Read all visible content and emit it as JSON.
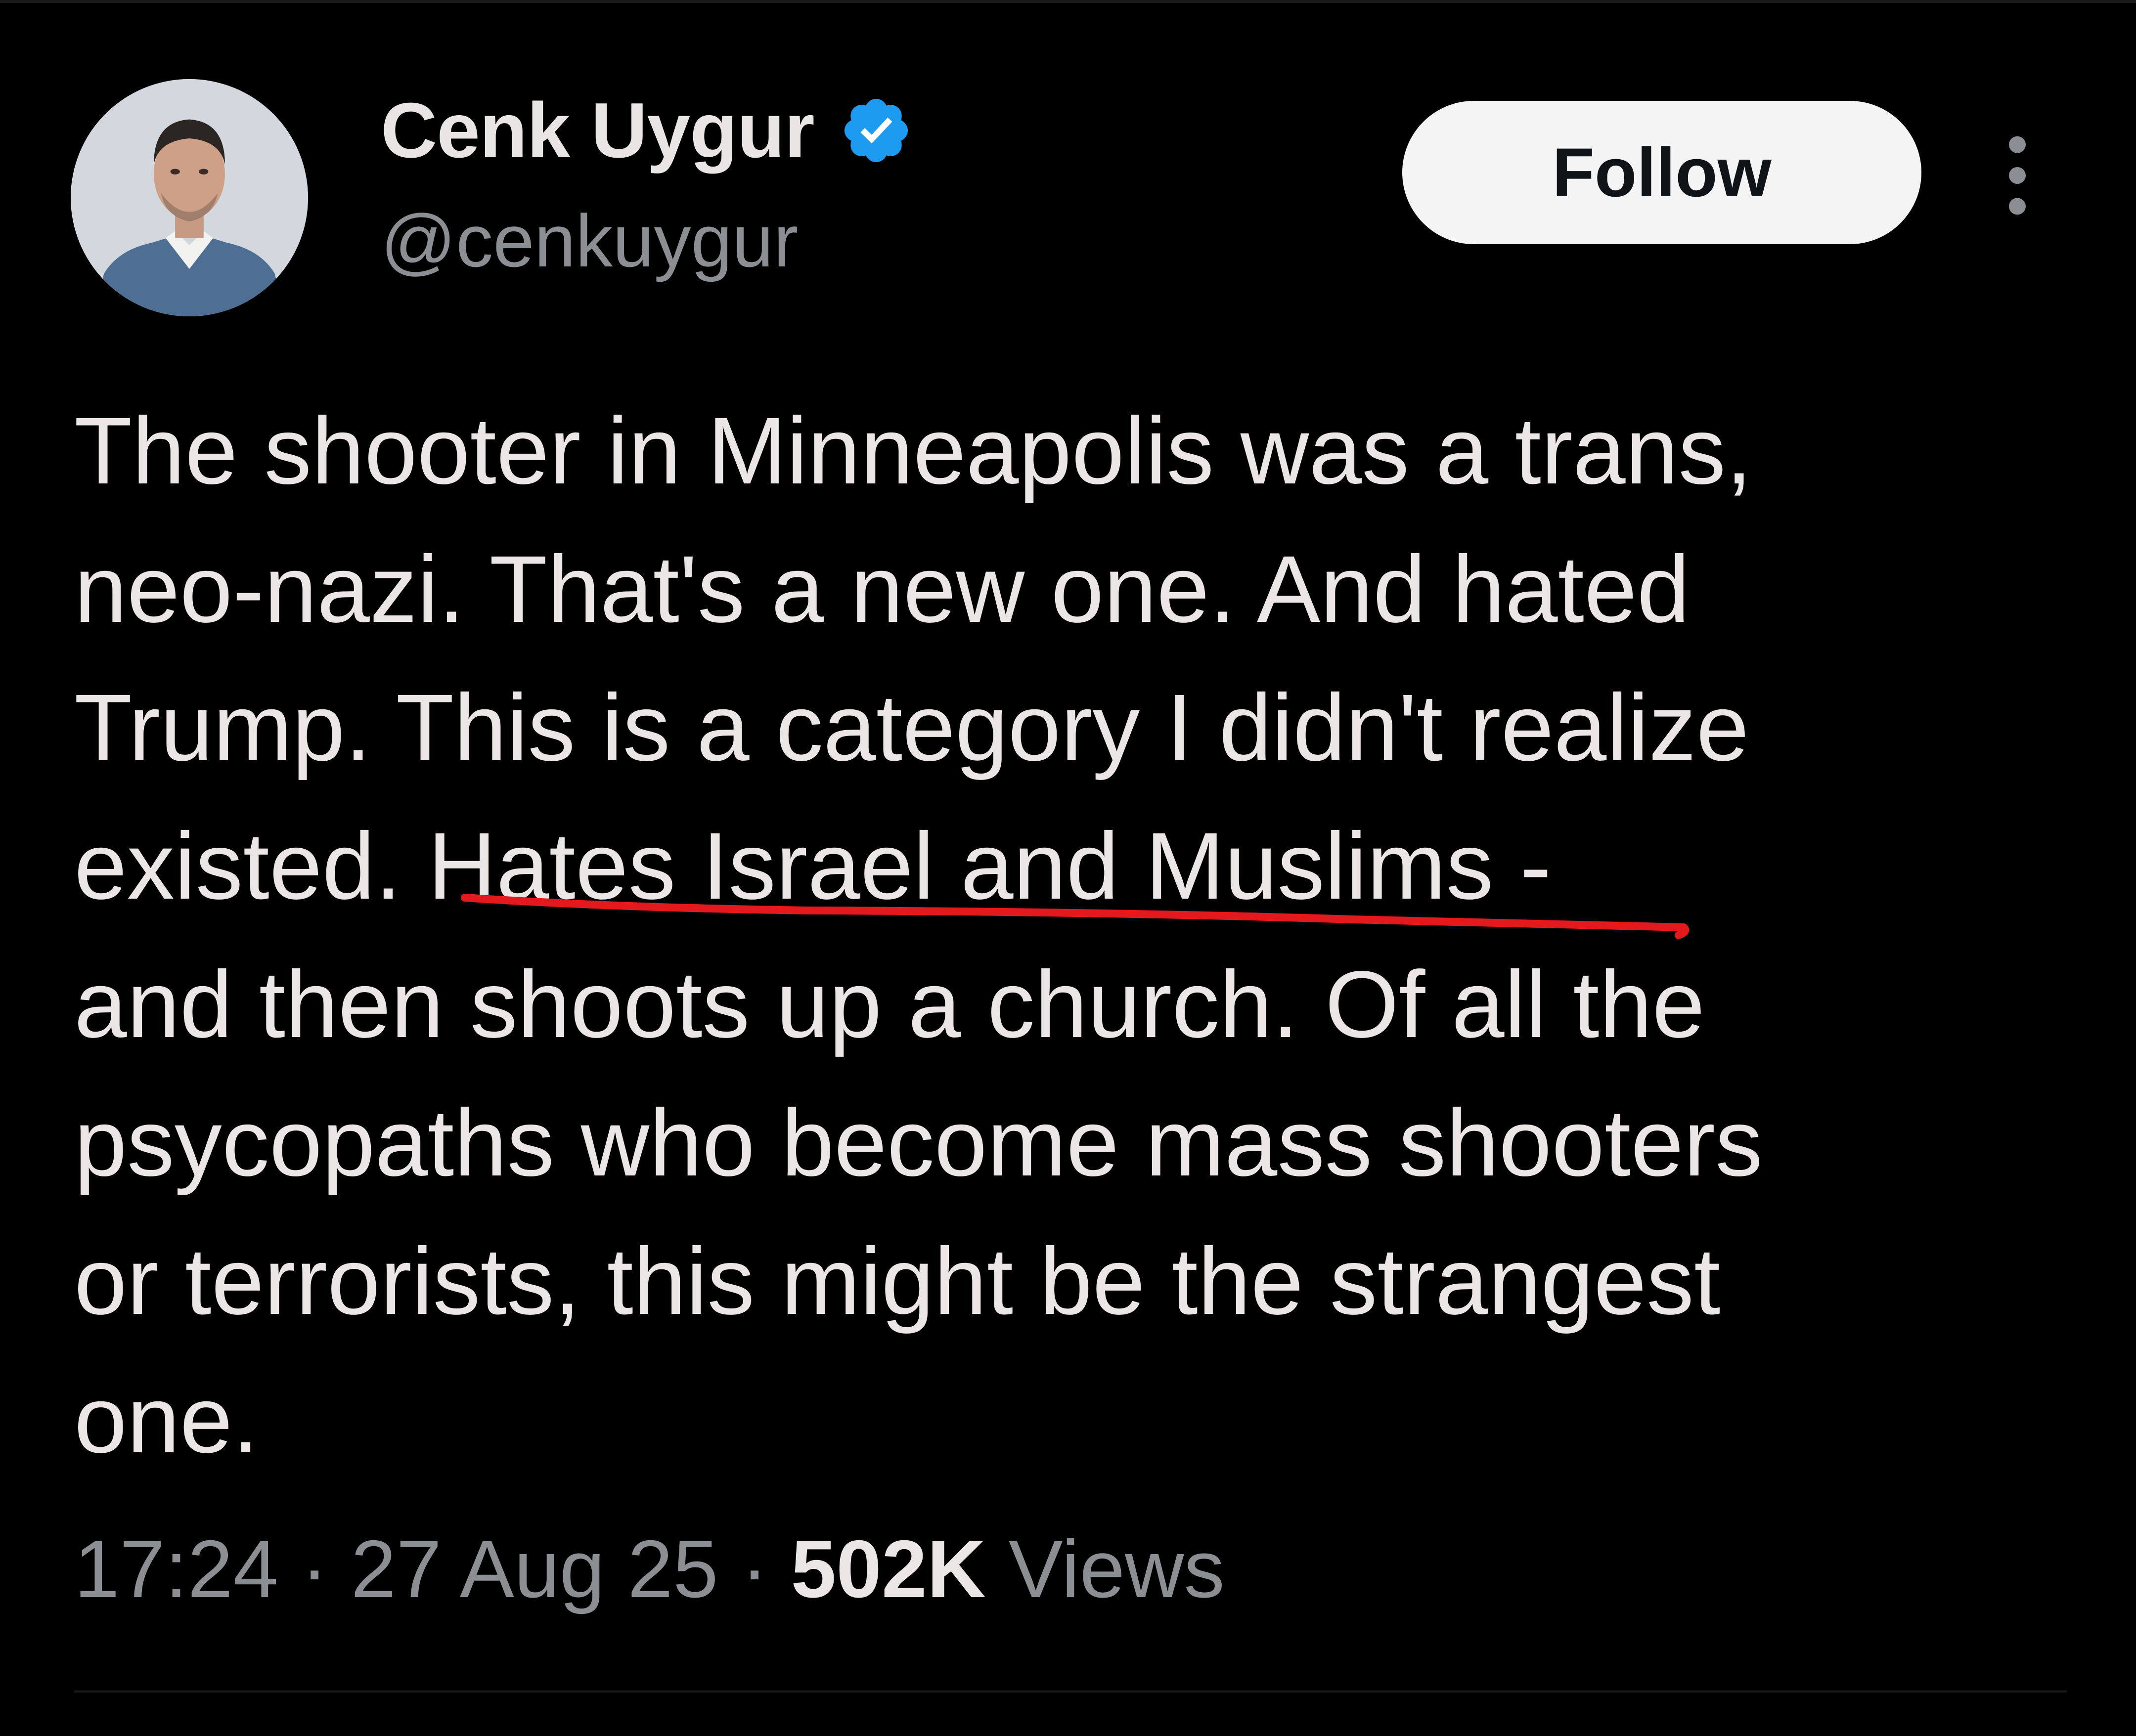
{
  "author": {
    "display_name": "Cenk Uygur",
    "handle": "@cenkuygur",
    "verified_icon": "verified-badge-icon",
    "verified_color": "#1d9bf0"
  },
  "actions": {
    "follow_label": "Follow",
    "more_icon": "more-vertical-icon"
  },
  "tweet": {
    "lines": [
      "The shooter in Minneapolis was a trans,",
      "neo-nazi. That's a new one. And hated",
      "Trump. This is a category I didn't realize",
      "existed. Hates Israel and Muslims -",
      "and then shoots up a church. Of all the",
      "psycopaths who become mass shooters",
      "or terrorists, this might be the strangest",
      "one."
    ],
    "highlight_phrase": "Hates Israel and Muslims",
    "highlight_color": "#e3191c"
  },
  "meta": {
    "time": "17:24",
    "separator": " · ",
    "date": "27 Aug 25",
    "views_count": "502K",
    "views_label": " Views"
  },
  "colors": {
    "background": "#000000",
    "text_primary": "#ebe6e5",
    "text_secondary": "#8b8f94",
    "button_bg": "#f4f4f4"
  }
}
